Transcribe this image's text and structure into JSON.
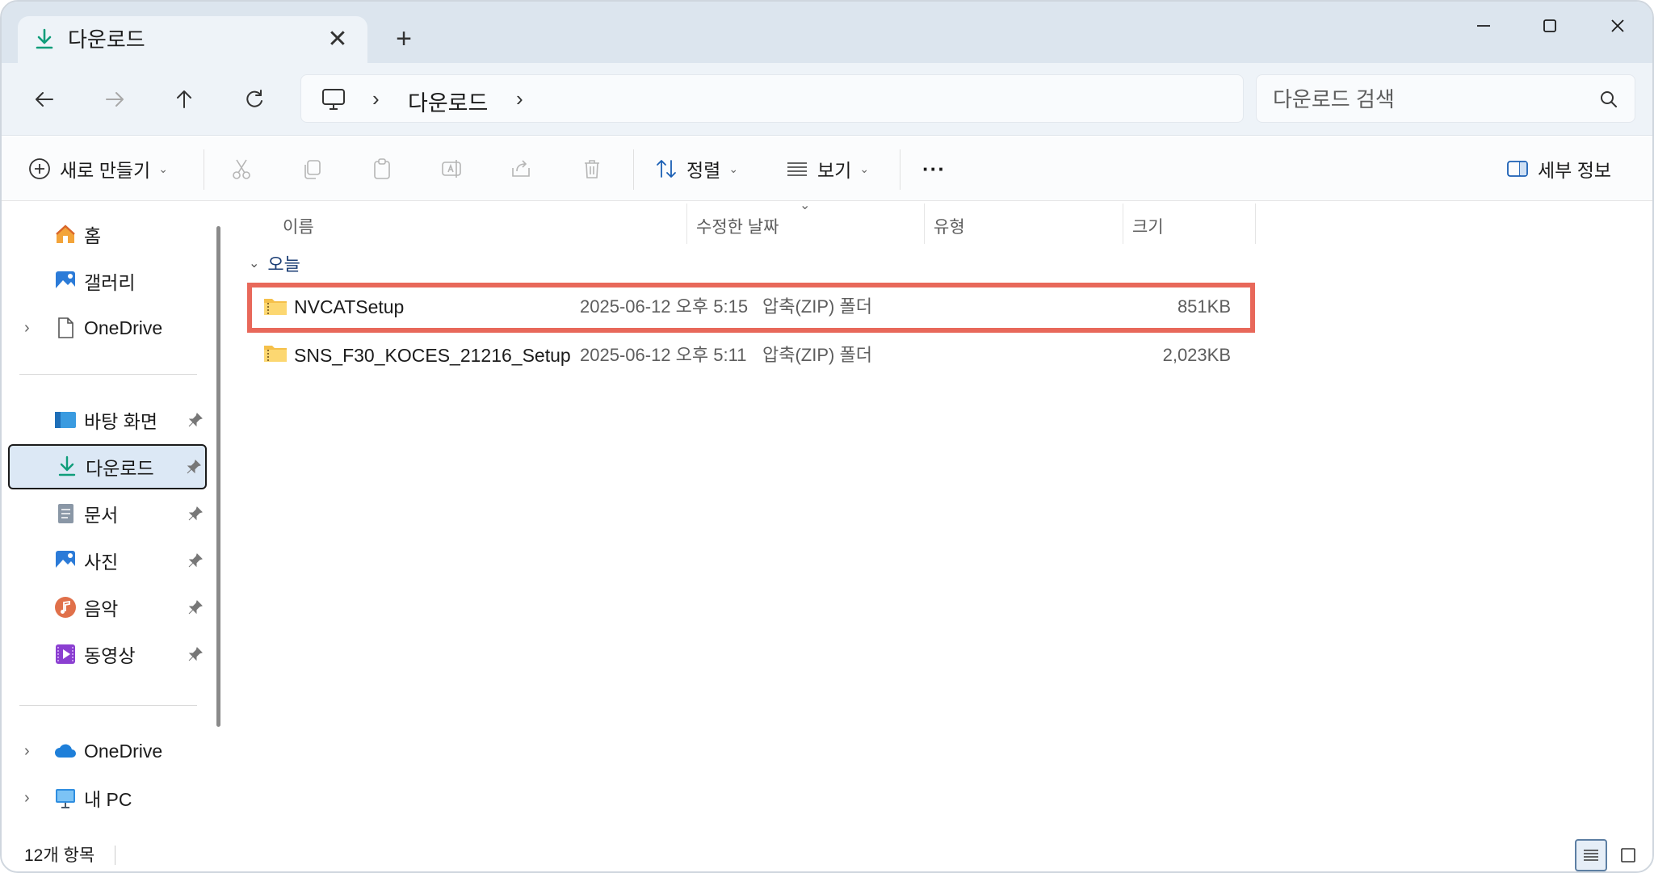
{
  "window": {
    "tab_title": "다운로드",
    "new_tab_glyph": "+",
    "close_tab_glyph": "✕"
  },
  "nav": {
    "breadcrumb_current": "다운로드",
    "search_placeholder": "다운로드 검색"
  },
  "command_bar": {
    "new_label": "새로 만들기",
    "sort_label": "정렬",
    "view_label": "보기",
    "more_label": "···",
    "details_label": "세부 정보"
  },
  "sidebar": {
    "items": [
      {
        "label": "홈",
        "icon": "home-icon"
      },
      {
        "label": "갤러리",
        "icon": "gallery-icon"
      },
      {
        "label": "OneDrive",
        "icon": "document-icon"
      },
      {
        "label": "바탕 화면",
        "icon": "desktop-icon"
      },
      {
        "label": "다운로드",
        "icon": "download-icon"
      },
      {
        "label": "문서",
        "icon": "documents-icon"
      },
      {
        "label": "사진",
        "icon": "pictures-icon"
      },
      {
        "label": "음악",
        "icon": "music-icon"
      },
      {
        "label": "동영상",
        "icon": "videos-icon"
      },
      {
        "label": "OneDrive",
        "icon": "cloud-icon"
      },
      {
        "label": "내 PC",
        "icon": "pc-icon"
      }
    ]
  },
  "list": {
    "columns": {
      "name": "이름",
      "date": "수정한 날짜",
      "type": "유형",
      "size": "크기"
    },
    "group_label": "오늘",
    "rows": [
      {
        "name": "NVCATSetup",
        "date": "2025-06-12 오후 5:15",
        "type": "압축(ZIP) 폴더",
        "size": "851KB"
      },
      {
        "name": "SNS_F30_KOCES_21216_Setup",
        "date": "2025-06-12 오후 5:11",
        "type": "압축(ZIP) 폴더",
        "size": "2,023KB"
      }
    ]
  },
  "status": {
    "item_count": "12개 항목"
  },
  "colors": {
    "accent": "#0f7b6c",
    "highlight_border": "#e8685a",
    "selected_bg": "#dce8f5"
  }
}
